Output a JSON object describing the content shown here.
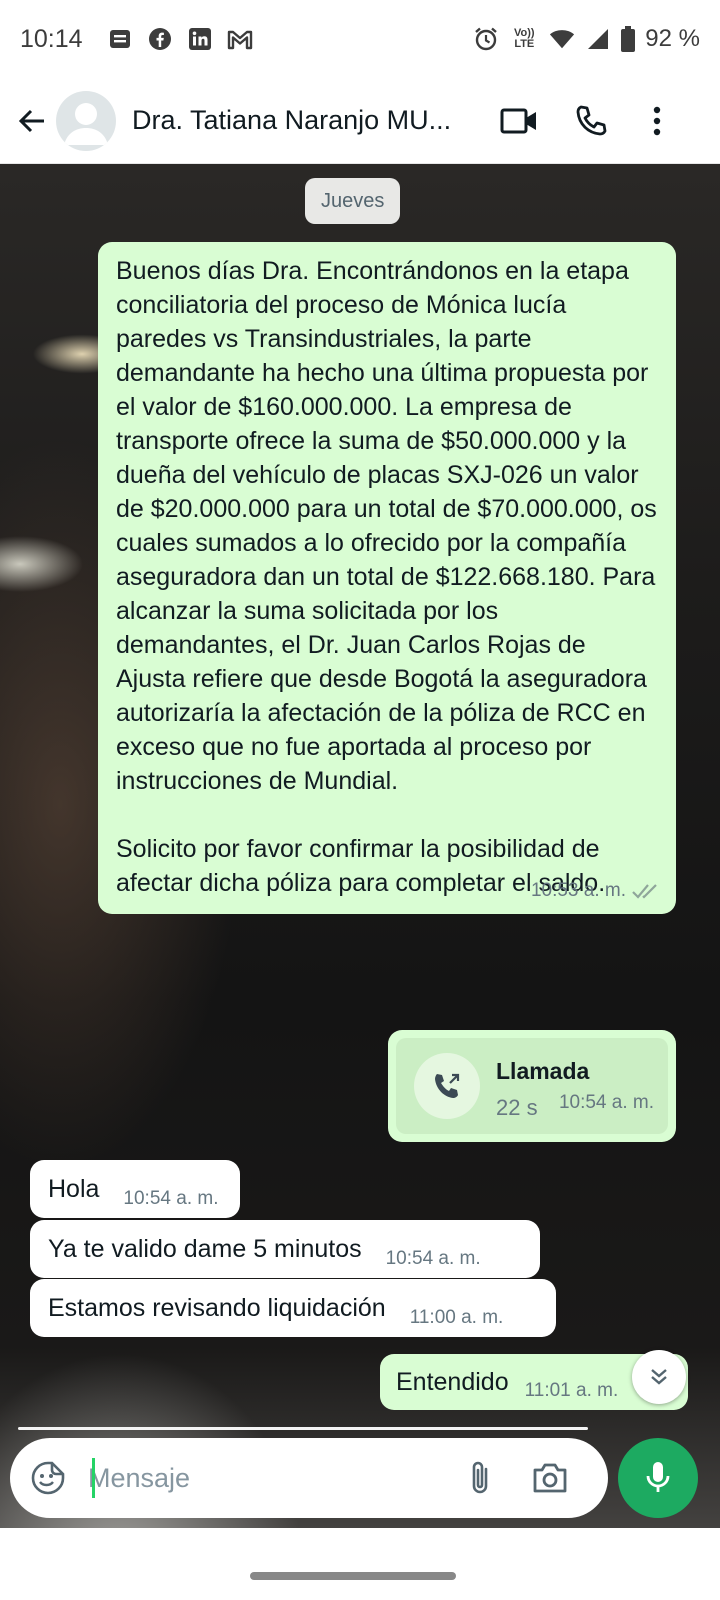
{
  "status_bar": {
    "time": "10:14",
    "battery": "92 %",
    "network_label": "Vo)) LTE",
    "notification_icons": [
      "notes-icon",
      "facebook-icon",
      "linkedin-icon",
      "gmail-icon"
    ]
  },
  "header": {
    "contact_name": "Dra. Tatiana Naranjo MU..."
  },
  "chat": {
    "date_chip": "Jueves",
    "messages": [
      {
        "direction": "outgoing",
        "text": "Buenos días Dra. Encontrándonos en la etapa conciliatoria del proceso de Mónica lucía paredes vs Transindustriales, la parte demandante ha hecho una última propuesta por el valor de $160.000.000. La empresa de transporte ofrece la suma de $50.000.000 y la dueña del vehículo de placas SXJ-026 un valor de $20.000.000 para un total de $70.000.000, os cuales sumados a lo ofrecido por la compañía aseguradora dan un total de $122.668.180. Para alcanzar la suma solicitada por los demandantes, el Dr. Juan Carlos Rojas de Ajusta refiere que desde Bogotá la aseguradora autorizaría la afectación de la póliza de RCC en exceso que no fue aportada al proceso por instrucciones de Mundial.\n\nSolicito por favor confirmar la posibilidad de afectar dicha póliza para completar el saldo.",
        "time": "10:53 a. m.",
        "status": "read"
      },
      {
        "direction": "outgoing",
        "type": "call",
        "title": "Llamada",
        "duration": "22 s",
        "time": "10:54 a. m."
      },
      {
        "direction": "incoming",
        "text": "Hola",
        "time": "10:54 a. m."
      },
      {
        "direction": "incoming",
        "text": "Ya te valido dame 5 minutos",
        "time": "10:54 a. m."
      },
      {
        "direction": "incoming",
        "text": "Estamos revisando liquidación",
        "time": "11:00 a. m."
      },
      {
        "direction": "outgoing",
        "text": "Entendido",
        "time": "11:01 a. m."
      }
    ]
  },
  "composer": {
    "placeholder": "Mensaje"
  },
  "colors": {
    "outgoing_bubble": "#d9fdd3",
    "incoming_bubble": "#ffffff",
    "accent_green": "#1daa61",
    "read_tick": "#8fa69a"
  }
}
